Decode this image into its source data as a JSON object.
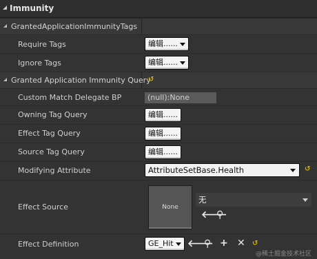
{
  "category": {
    "title": "Immunity"
  },
  "granted_tags": {
    "group_label": "GrantedApplicationImmunityTags",
    "rows": [
      {
        "label": "Require Tags",
        "button": "编辑......"
      },
      {
        "label": "Ignore Tags",
        "button": "编辑......"
      }
    ]
  },
  "immunity_query": {
    "group_label": "Granted Application Immunity Query",
    "custom_match": {
      "label": "Custom Match Delegate BP",
      "value": "(null):None"
    },
    "owning": {
      "label": "Owning Tag Query",
      "button": "编辑......"
    },
    "effect_tag": {
      "label": "Effect Tag Query",
      "button": "编辑......"
    },
    "source_tag": {
      "label": "Source Tag Query",
      "button": "编辑......"
    },
    "modifying": {
      "label": "Modifying Attribute",
      "value": "AttributeSetBase.Health"
    },
    "effect_source": {
      "label": "Effect Source",
      "thumb": "None",
      "value": "无"
    },
    "effect_def": {
      "label": "Effect Definition",
      "value": "GE_Hit"
    }
  },
  "watermark": "@稀土掘金技术社区",
  "colors": {
    "reset_arrow": "#d6b400",
    "background": "#383838",
    "header": "#2f2f2f"
  }
}
